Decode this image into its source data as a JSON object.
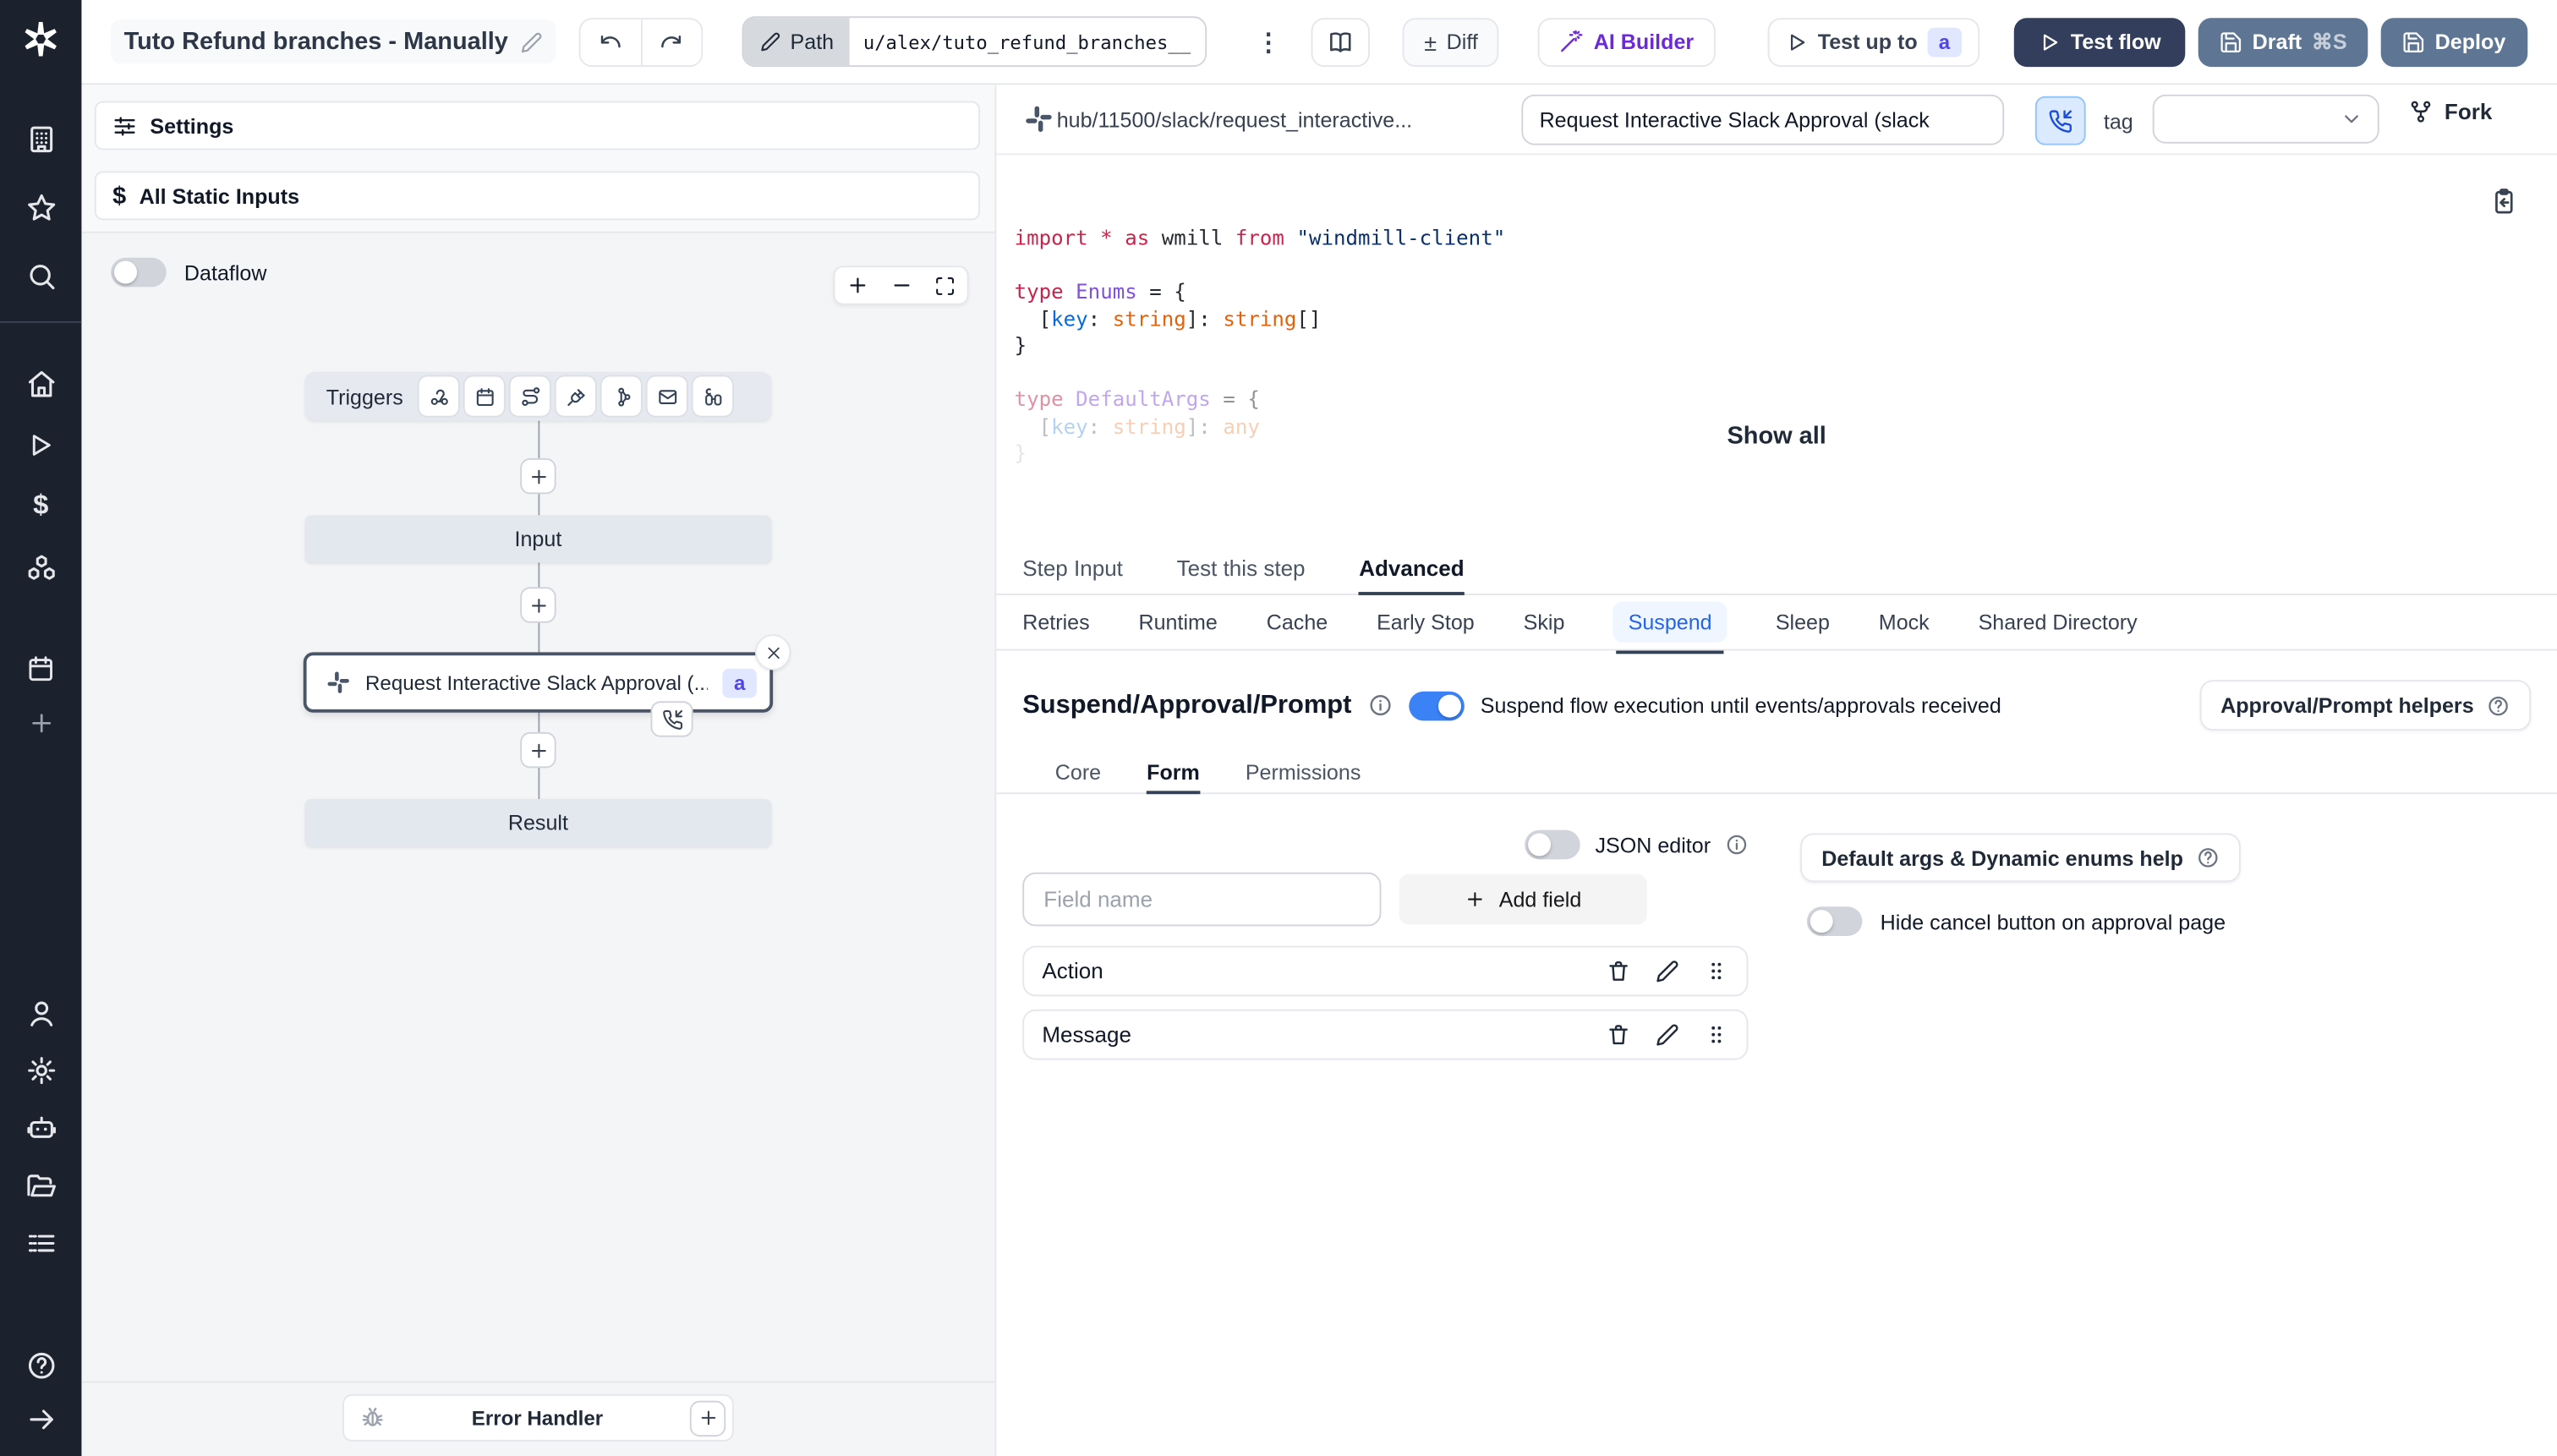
{
  "topbar": {
    "title": "Tuto Refund branches - Manually",
    "path_button": "Path",
    "path_value": "u/alex/tuto_refund_branches__",
    "more_icon": "⋮",
    "diff_icon": "±",
    "diff": "Diff",
    "ai_builder": "AI Builder",
    "test_up_to": "Test up to",
    "test_up_to_badge": "a",
    "test_flow": "Test flow",
    "draft": "Draft",
    "draft_shortcut": "⌘S",
    "deploy": "Deploy"
  },
  "flow_panel": {
    "settings": "Settings",
    "all_static_inputs": "All Static Inputs",
    "static_inputs_icon": "$",
    "dataflow": "Dataflow",
    "graph": {
      "triggers_label": "Triggers",
      "input_label": "Input",
      "step_label": "Request Interactive Slack Approval (...",
      "step_badge": "a",
      "result_label": "Result",
      "error_handler": "Error Handler"
    }
  },
  "step_panel": {
    "hub_path": "hub/11500/slack/request_interactive...",
    "summary_value": "Request Interactive Slack Approval (slack",
    "tag_label": "tag",
    "fork": "Fork",
    "show_all": "Show all",
    "code": {
      "plain_text": "import * as wmill from \"windmill-client\"\n\ntype Enums = {\n  [key: string]: string[]\n}\n\ntype DefaultArgs = {\n  [key: string]: any\n}",
      "lines": [
        {
          "o": 1,
          "t": [
            [
              "k",
              "import"
            ],
            [
              "p",
              " "
            ],
            [
              "k",
              "*"
            ],
            [
              "p",
              " "
            ],
            [
              "k",
              "as"
            ],
            [
              "p",
              " wmill "
            ],
            [
              "k",
              "from"
            ],
            [
              "p",
              " "
            ],
            [
              "s",
              "\"windmill-client\""
            ]
          ]
        },
        {
          "o": 1,
          "t": []
        },
        {
          "o": 1,
          "t": [
            [
              "k",
              "type"
            ],
            [
              "p",
              " "
            ],
            [
              "y",
              "Enums"
            ],
            [
              "p",
              " = {"
            ]
          ]
        },
        {
          "o": 1,
          "t": [
            [
              "p",
              "  ["
            ],
            [
              "b",
              "key"
            ],
            [
              "p",
              ": "
            ],
            [
              "n",
              "string"
            ],
            [
              "p",
              "]: "
            ],
            [
              "n",
              "string"
            ],
            [
              "p",
              "[]"
            ]
          ]
        },
        {
          "o": 1,
          "t": [
            [
              "p",
              "}"
            ]
          ]
        },
        {
          "o": 1,
          "t": []
        },
        {
          "o": 0.5,
          "t": [
            [
              "k",
              "type"
            ],
            [
              "p",
              " "
            ],
            [
              "y",
              "DefaultArgs"
            ],
            [
              "p",
              " = {"
            ]
          ]
        },
        {
          "o": 0.3,
          "t": [
            [
              "p",
              "  ["
            ],
            [
              "b",
              "key"
            ],
            [
              "p",
              ": "
            ],
            [
              "n",
              "string"
            ],
            [
              "p",
              "]: "
            ],
            [
              "n",
              "any"
            ]
          ]
        },
        {
          "o": 0.12,
          "t": [
            [
              "p",
              "}"
            ]
          ]
        }
      ]
    },
    "tabs": [
      "Step Input",
      "Test this step",
      "Advanced"
    ],
    "active_tab": "Advanced",
    "subtabs": [
      "Retries",
      "Runtime",
      "Cache",
      "Early Stop",
      "Skip",
      "Suspend",
      "Sleep",
      "Mock",
      "Shared Directory"
    ],
    "active_subtab": "Suspend",
    "suspend": {
      "heading": "Suspend/Approval/Prompt",
      "toggle_on": true,
      "toggle_label": "Suspend flow execution until events/approvals received",
      "helpers_button": "Approval/Prompt helpers",
      "tabs": [
        "Core",
        "Form",
        "Permissions"
      ],
      "active_tab": "Form",
      "json_editor_label": "JSON editor",
      "json_editor_on": false,
      "field_name_placeholder": "Field name",
      "add_field": "Add field",
      "fields": [
        {
          "name": "Action"
        },
        {
          "name": "Message"
        }
      ],
      "default_args_help": "Default args & Dynamic enums help",
      "hide_cancel_label": "Hide cancel button on approval page",
      "hide_cancel_on": false
    }
  },
  "colors": {
    "accent_blue": "#3b82f6",
    "active_subtab_blue": "#2563eb",
    "badge_indigo_bg": "#e0e7ff",
    "badge_indigo_text": "#4f46e5",
    "sidebar_dark": "#1c212e",
    "test_flow_navy": "#333e5c",
    "draft_deploy_slate": "#5e7694",
    "ai_builder_purple": "#6d28d9"
  },
  "icons": {
    "sidebar": [
      "windmill-logo",
      "workspace-building",
      "favorites-star",
      "search",
      "home",
      "runs-play",
      "variables-dollar",
      "resources-boxes",
      "schedules-calendar",
      "create-plus",
      "user",
      "settings-gear",
      "workers-robot",
      "folders",
      "logs-list",
      "help-circle",
      "expand-arrow-right"
    ],
    "triggers": [
      "webhook",
      "schedule-calendar",
      "http-route",
      "websocket-plug",
      "event-stream",
      "email",
      "scheduled-poll"
    ],
    "misc": [
      "pencil-edit",
      "undo",
      "redo",
      "book-open",
      "wand-sparkles",
      "play",
      "save-floppy",
      "slack-logo",
      "phone-incoming",
      "fork-git",
      "info-circle",
      "help-circle",
      "clipboard-import",
      "trash",
      "grip-dots",
      "bug",
      "close-x",
      "chevron-down",
      "zoom-plus",
      "zoom-minus",
      "fit-view"
    ]
  }
}
